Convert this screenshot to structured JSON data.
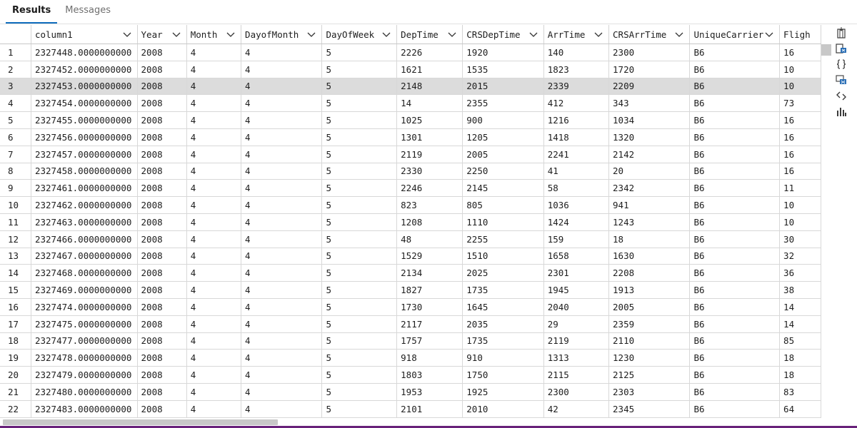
{
  "tabs": [
    {
      "label": "Results",
      "active": true
    },
    {
      "label": "Messages",
      "active": false
    }
  ],
  "grid": {
    "columns": [
      "column1",
      "Year",
      "Month",
      "DayofMonth",
      "DayOfWeek",
      "DepTime",
      "CRSDepTime",
      "ArrTime",
      "CRSArrTime",
      "UniqueCarrier",
      "Flight"
    ],
    "column_header_text": [
      "column1",
      "Year",
      "Month",
      "DayofMonth",
      "DayOfWeek",
      "DepTime",
      "CRSDepTime",
      "ArrTime",
      "CRSArrTime",
      "UniqueCarrier",
      "Fligh"
    ],
    "selected_row": 3,
    "rows": [
      [
        "1",
        "2327448.0000000000",
        "2008",
        "4",
        "4",
        "5",
        "2226",
        "1920",
        "140",
        "2300",
        "B6",
        "16"
      ],
      [
        "2",
        "2327452.0000000000",
        "2008",
        "4",
        "4",
        "5",
        "1621",
        "1535",
        "1823",
        "1720",
        "B6",
        "10"
      ],
      [
        "3",
        "2327453.0000000000",
        "2008",
        "4",
        "4",
        "5",
        "2148",
        "2015",
        "2339",
        "2209",
        "B6",
        "10"
      ],
      [
        "4",
        "2327454.0000000000",
        "2008",
        "4",
        "4",
        "5",
        "14",
        "2355",
        "412",
        "343",
        "B6",
        "73"
      ],
      [
        "5",
        "2327455.0000000000",
        "2008",
        "4",
        "4",
        "5",
        "1025",
        "900",
        "1216",
        "1034",
        "B6",
        "16"
      ],
      [
        "6",
        "2327456.0000000000",
        "2008",
        "4",
        "4",
        "5",
        "1301",
        "1205",
        "1418",
        "1320",
        "B6",
        "16"
      ],
      [
        "7",
        "2327457.0000000000",
        "2008",
        "4",
        "4",
        "5",
        "2119",
        "2005",
        "2241",
        "2142",
        "B6",
        "16"
      ],
      [
        "8",
        "2327458.0000000000",
        "2008",
        "4",
        "4",
        "5",
        "2330",
        "2250",
        "41",
        "20",
        "B6",
        "16"
      ],
      [
        "9",
        "2327461.0000000000",
        "2008",
        "4",
        "4",
        "5",
        "2246",
        "2145",
        "58",
        "2342",
        "B6",
        "11"
      ],
      [
        "10",
        "2327462.0000000000",
        "2008",
        "4",
        "4",
        "5",
        "823",
        "805",
        "1036",
        "941",
        "B6",
        "10"
      ],
      [
        "11",
        "2327463.0000000000",
        "2008",
        "4",
        "4",
        "5",
        "1208",
        "1110",
        "1424",
        "1243",
        "B6",
        "10"
      ],
      [
        "12",
        "2327466.0000000000",
        "2008",
        "4",
        "4",
        "5",
        "48",
        "2255",
        "159",
        "18",
        "B6",
        "30"
      ],
      [
        "13",
        "2327467.0000000000",
        "2008",
        "4",
        "4",
        "5",
        "1529",
        "1510",
        "1658",
        "1630",
        "B6",
        "32"
      ],
      [
        "14",
        "2327468.0000000000",
        "2008",
        "4",
        "4",
        "5",
        "2134",
        "2025",
        "2301",
        "2208",
        "B6",
        "36"
      ],
      [
        "15",
        "2327469.0000000000",
        "2008",
        "4",
        "4",
        "5",
        "1827",
        "1735",
        "1945",
        "1913",
        "B6",
        "38"
      ],
      [
        "16",
        "2327474.0000000000",
        "2008",
        "4",
        "4",
        "5",
        "1730",
        "1645",
        "2040",
        "2005",
        "B6",
        "14"
      ],
      [
        "17",
        "2327475.0000000000",
        "2008",
        "4",
        "4",
        "5",
        "2117",
        "2035",
        "29",
        "2359",
        "B6",
        "14"
      ],
      [
        "18",
        "2327477.0000000000",
        "2008",
        "4",
        "4",
        "5",
        "1757",
        "1735",
        "2119",
        "2110",
        "B6",
        "85"
      ],
      [
        "19",
        "2327478.0000000000",
        "2008",
        "4",
        "4",
        "5",
        "918",
        "910",
        "1313",
        "1230",
        "B6",
        "18"
      ],
      [
        "20",
        "2327479.0000000000",
        "2008",
        "4",
        "4",
        "5",
        "1803",
        "1750",
        "2115",
        "2125",
        "B6",
        "18"
      ],
      [
        "21",
        "2327480.0000000000",
        "2008",
        "4",
        "4",
        "5",
        "1953",
        "1925",
        "2300",
        "2303",
        "B6",
        "83"
      ],
      [
        "22",
        "2327483.0000000000",
        "2008",
        "4",
        "4",
        "5",
        "2101",
        "2010",
        "42",
        "2345",
        "B6",
        "64"
      ]
    ]
  },
  "toolbar": {
    "icons": [
      "save-as-csv-icon",
      "save-as-excel-icon",
      "save-as-json-icon",
      "save-as-xml-icon",
      "copy-results-icon",
      "chart-icon"
    ]
  },
  "colors": {
    "accent": "#0f6cbd",
    "selected_row": "#dcdcdc",
    "status_bar": "#68217a"
  }
}
